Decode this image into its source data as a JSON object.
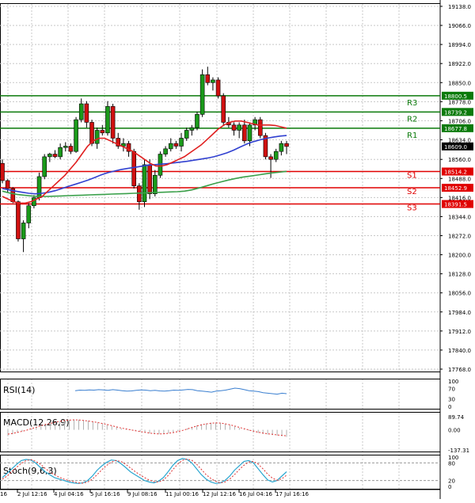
{
  "chart_data": {
    "type": "candlestick",
    "main": {
      "y_ticks": [
        "19138.0",
        "19066.0",
        "18994.0",
        "18922.0",
        "18850.0",
        "18778.0",
        "18706.0",
        "18634.0",
        "18560.0",
        "18488.0",
        "18416.0",
        "18344.0",
        "18272.0",
        "18200.0",
        "18128.0",
        "18056.0",
        "17984.0",
        "17912.0",
        "17840.0",
        "17768.0"
      ],
      "ylim": [
        17768,
        19138
      ],
      "current_price": "18609.0",
      "levels": [
        {
          "name": "R3",
          "value": 18800.5,
          "label": "18800.5",
          "color": "#0a7a0a"
        },
        {
          "name": "R2",
          "value": 18739.2,
          "label": "18739.2",
          "color": "#0a7a0a"
        },
        {
          "name": "R1",
          "value": 18677.8,
          "label": "18677.8",
          "color": "#0a7a0a"
        },
        {
          "name": "S1",
          "value": 18514.2,
          "label": "18514.2",
          "color": "#e00000"
        },
        {
          "name": "S2",
          "value": 18452.9,
          "label": "18452.9",
          "color": "#e00000"
        },
        {
          "name": "S3",
          "value": 18391.5,
          "label": "18391.5",
          "color": "#e00000"
        }
      ],
      "ohlc": [
        [
          18545,
          18560,
          18470,
          18480
        ],
        [
          18480,
          18485,
          18435,
          18450
        ],
        [
          18450,
          18455,
          18395,
          18400
        ],
        [
          18400,
          18405,
          18250,
          18260
        ],
        [
          18260,
          18330,
          18210,
          18320
        ],
        [
          18320,
          18395,
          18300,
          18385
        ],
        [
          18385,
          18425,
          18375,
          18415
        ],
        [
          18415,
          18510,
          18405,
          18495
        ],
        [
          18495,
          18580,
          18485,
          18570
        ],
        [
          18570,
          18585,
          18550,
          18580
        ],
        [
          18580,
          18595,
          18565,
          18570
        ],
        [
          18570,
          18620,
          18560,
          18605
        ],
        [
          18605,
          18625,
          18590,
          18610
        ],
        [
          18610,
          18620,
          18580,
          18590
        ],
        [
          18590,
          18720,
          18585,
          18710
        ],
        [
          18710,
          18790,
          18700,
          18770
        ],
        [
          18770,
          18780,
          18680,
          18700
        ],
        [
          18700,
          18710,
          18610,
          18620
        ],
        [
          18620,
          18680,
          18600,
          18670
        ],
        [
          18670,
          18690,
          18650,
          18660
        ],
        [
          18660,
          18780,
          18650,
          18760
        ],
        [
          18760,
          18770,
          18620,
          18640
        ],
        [
          18640,
          18660,
          18600,
          18610
        ],
        [
          18610,
          18640,
          18590,
          18620
        ],
        [
          18620,
          18630,
          18570,
          18590
        ],
        [
          18590,
          18600,
          18450,
          18460
        ],
        [
          18460,
          18470,
          18370,
          18400
        ],
        [
          18400,
          18560,
          18380,
          18540
        ],
        [
          18540,
          18560,
          18410,
          18430
        ],
        [
          18430,
          18520,
          18420,
          18500
        ],
        [
          18500,
          18590,
          18490,
          18580
        ],
        [
          18580,
          18610,
          18570,
          18600
        ],
        [
          18600,
          18640,
          18590,
          18620
        ],
        [
          18620,
          18630,
          18600,
          18610
        ],
        [
          18610,
          18660,
          18590,
          18640
        ],
        [
          18640,
          18680,
          18630,
          18670
        ],
        [
          18670,
          18690,
          18650,
          18680
        ],
        [
          18680,
          18740,
          18670,
          18730
        ],
        [
          18730,
          18900,
          18720,
          18880
        ],
        [
          18880,
          18910,
          18840,
          18850
        ],
        [
          18850,
          18870,
          18820,
          18860
        ],
        [
          18860,
          18870,
          18790,
          18800
        ],
        [
          18800,
          18810,
          18690,
          18700
        ],
        [
          18700,
          18720,
          18680,
          18690
        ],
        [
          18690,
          18700,
          18650,
          18670
        ],
        [
          18670,
          18700,
          18640,
          18690
        ],
        [
          18690,
          18710,
          18620,
          18630
        ],
        [
          18630,
          18700,
          18610,
          18690
        ],
        [
          18690,
          18720,
          18670,
          18710
        ],
        [
          18710,
          18720,
          18640,
          18650
        ],
        [
          18650,
          18660,
          18560,
          18570
        ],
        [
          18570,
          18580,
          18490,
          18560
        ],
        [
          18560,
          18600,
          18550,
          18590
        ],
        [
          18590,
          18630,
          18575,
          18620
        ],
        [
          18620,
          18630,
          18580,
          18609
        ]
      ],
      "ma_red": [
        18420,
        18410,
        18400,
        18395,
        18395,
        18400,
        18410,
        18420,
        18440,
        18460,
        18480,
        18500,
        18525,
        18550,
        18580,
        18610,
        18630,
        18640,
        18640,
        18630,
        18620,
        18610,
        18600,
        18590,
        18575,
        18560,
        18545,
        18535,
        18535,
        18540,
        18550,
        18560,
        18570,
        18585,
        18600,
        18615,
        18635,
        18655,
        18675,
        18690,
        18700,
        18705,
        18705,
        18700,
        18695,
        18690,
        18690,
        18690,
        18688,
        18683,
        18678
      ],
      "ma_blue": [
        18450,
        18445,
        18440,
        18436,
        18432,
        18430,
        18432,
        18436,
        18442,
        18450,
        18458,
        18466,
        18474,
        18482,
        18492,
        18502,
        18510,
        18516,
        18522,
        18526,
        18530,
        18534,
        18538,
        18540,
        18542,
        18544,
        18547,
        18550,
        18553,
        18557,
        18561,
        18565,
        18570,
        18577,
        18585,
        18595,
        18607,
        18618,
        18627,
        18634,
        18640,
        18644,
        18648,
        18650
      ],
      "ma_green": [
        18440,
        18433,
        18428,
        18425,
        18422,
        18420,
        18420,
        18421,
        18422,
        18423,
        18424,
        18425,
        18426,
        18427,
        18428,
        18429,
        18430,
        18431,
        18432,
        18433,
        18434,
        18435,
        18436,
        18437,
        18438,
        18440,
        18445,
        18452,
        18460,
        18468,
        18475,
        18482,
        18488,
        18493,
        18497,
        18501,
        18505,
        18509,
        18512,
        18515
      ]
    },
    "rsi": {
      "label": "RSI(14)",
      "ticks": [
        "100",
        "70",
        "30",
        "0"
      ],
      "values": [
        62,
        64,
        63,
        65,
        64,
        66,
        65,
        63,
        66,
        64,
        62,
        60,
        61,
        63,
        65,
        64,
        62,
        63,
        61,
        60,
        62,
        64,
        63,
        65,
        67,
        66,
        62,
        60,
        58,
        56,
        60,
        62,
        64,
        68,
        72,
        70,
        66,
        62,
        60,
        58,
        54,
        52,
        50,
        48,
        52,
        50
      ]
    },
    "macd": {
      "label": "MACD(12,26,9)",
      "ticks": [
        "89.74",
        "0.00",
        "-137.31"
      ],
      "histogram": [
        -40,
        -30,
        -20,
        -10,
        0,
        10,
        20,
        30,
        40,
        48,
        55,
        60,
        65,
        68,
        70,
        69,
        66,
        62,
        56,
        50,
        42,
        34,
        26,
        18,
        10,
        4,
        -2,
        -8,
        -14,
        -20,
        -25,
        -28,
        -30,
        -28,
        -24,
        -18,
        -10,
        0,
        10,
        20,
        30,
        38,
        44,
        48,
        50,
        48,
        42,
        34,
        24,
        14,
        4,
        -6,
        -14,
        -22,
        -28,
        -32,
        -36,
        -40,
        -44,
        -48
      ],
      "signal": [
        -30,
        -25,
        -18,
        -10,
        -2,
        8,
        18,
        28,
        36,
        44,
        52,
        58,
        63,
        66,
        68,
        67,
        64,
        60,
        55,
        50,
        43,
        36,
        28,
        20,
        12,
        6,
        0,
        -6,
        -12,
        -17,
        -22,
        -26,
        -28,
        -27,
        -24,
        -19,
        -12,
        -4,
        6,
        16,
        26,
        34,
        40,
        45,
        47,
        46,
        41,
        34,
        26,
        17,
        8,
        -1,
        -9,
        -16,
        -22,
        -27,
        -31,
        -35,
        -38,
        -41
      ]
    },
    "stoch": {
      "label": "Stoch(9,6,3)",
      "ticks": [
        "100",
        "80",
        "20",
        "0"
      ],
      "k": [
        30,
        45,
        60,
        75,
        88,
        92,
        90,
        80,
        65,
        50,
        40,
        30,
        25,
        20,
        15,
        12,
        10,
        12,
        20,
        35,
        55,
        70,
        82,
        90,
        88,
        78,
        65,
        50,
        40,
        30,
        20,
        15,
        12,
        18,
        30,
        50,
        72,
        88,
        95,
        92,
        80,
        60,
        40,
        25,
        15,
        10,
        12,
        20,
        35,
        55,
        70,
        85,
        88,
        80,
        60,
        40,
        22,
        15,
        20,
        35,
        50
      ],
      "d": [
        25,
        35,
        50,
        65,
        78,
        88,
        91,
        86,
        76,
        62,
        50,
        40,
        31,
        25,
        20,
        16,
        12,
        11,
        15,
        25,
        40,
        57,
        71,
        83,
        88,
        85,
        76,
        63,
        51,
        40,
        30,
        22,
        16,
        15,
        22,
        37,
        57,
        76,
        89,
        93,
        89,
        76,
        58,
        40,
        27,
        17,
        12,
        15,
        25,
        40,
        57,
        72,
        83,
        85,
        76,
        60,
        42,
        28,
        21,
        26,
        38
      ]
    },
    "x_ticks": [
      "2 Jul 12:16",
      "4 Jul 04:16",
      "5 Jul 16:16",
      "9 Jul 08:16",
      "11 Jul 00:16",
      "12 Jul 12:16",
      "16 Jul 04:16",
      "17 Jul 16:16"
    ],
    "x_tick_first": "16"
  }
}
